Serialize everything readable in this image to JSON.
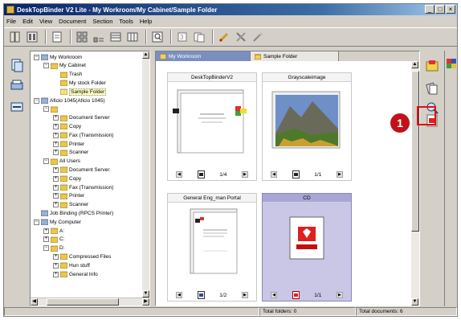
{
  "window": {
    "title": "DeskTopBinder V2 Lite - My Workroom/My Cabinet/Sample Folder",
    "controls": [
      "_",
      "□",
      "×"
    ]
  },
  "menu": [
    "File",
    "Edit",
    "View",
    "Document",
    "Section",
    "Tools",
    "Help"
  ],
  "toolbar_icons": [
    "binder-icon",
    "binder2-icon",
    "properties-icon",
    "thumbnails-icon",
    "details-icon",
    "list-icon",
    "zoom-icon",
    "print-icon",
    "copy-icon",
    "pen-icon",
    "tools-icon",
    "wand-icon"
  ],
  "tree": [
    {
      "label": "My Workroom",
      "level": 0,
      "expander": "−"
    },
    {
      "label": "My Cabinet",
      "level": 1,
      "expander": "−"
    },
    {
      "label": "Trash",
      "level": 2,
      "expander": ""
    },
    {
      "label": "My stock Folder",
      "level": 2,
      "expander": ""
    },
    {
      "label": "Sample Folder",
      "level": 2,
      "expander": "",
      "selected": true
    },
    {
      "label": "Aficio 1045(Aficio 1045)",
      "level": 0,
      "expander": "−"
    },
    {
      "label": "",
      "level": 1,
      "expander": "−"
    },
    {
      "label": "Document Server",
      "level": 2,
      "expander": "+"
    },
    {
      "label": "Copy",
      "level": 2,
      "expander": "+"
    },
    {
      "label": "Fax (Transmission)",
      "level": 2,
      "expander": "+"
    },
    {
      "label": "Printer",
      "level": 2,
      "expander": "+"
    },
    {
      "label": "Scanner",
      "level": 2,
      "expander": "+"
    },
    {
      "label": "All Users",
      "level": 1,
      "expander": "−"
    },
    {
      "label": "Document Server",
      "level": 2,
      "expander": "+"
    },
    {
      "label": "Copy",
      "level": 2,
      "expander": "+"
    },
    {
      "label": "Fax (Transmission)",
      "level": 2,
      "expander": "+"
    },
    {
      "label": "Printer",
      "level": 2,
      "expander": "+"
    },
    {
      "label": "Scanner",
      "level": 2,
      "expander": "+"
    },
    {
      "label": "Job Binding (RPCS Printer)",
      "level": 0,
      "expander": ""
    },
    {
      "label": "My Computer",
      "level": 0,
      "expander": "−"
    },
    {
      "label": "A:",
      "level": 1,
      "expander": "+"
    },
    {
      "label": "C:",
      "level": 1,
      "expander": "+"
    },
    {
      "label": "D:",
      "level": 1,
      "expander": "−"
    },
    {
      "label": "Compressed Files",
      "level": 2,
      "expander": "+"
    },
    {
      "label": "Hun stuff",
      "level": 2,
      "expander": "+"
    },
    {
      "label": "General Info",
      "level": 2,
      "expander": "+"
    }
  ],
  "tabs": [
    {
      "label": "My Workroom",
      "active": true
    },
    {
      "label": "Sample Folder",
      "active": false
    }
  ],
  "documents": [
    {
      "name": "DeskTopBinderV2",
      "page": "1/4",
      "kind": "doc",
      "selected": false
    },
    {
      "name": "Grayscaleimage",
      "page": "1/1",
      "kind": "photo",
      "selected": false
    },
    {
      "name": "General Eng_man Portal",
      "page": "1/2",
      "kind": "doc2",
      "selected": false
    },
    {
      "name": "CD",
      "page": "1/1",
      "kind": "pdf",
      "selected": true
    }
  ],
  "callout": {
    "number": "1"
  },
  "status": {
    "folders": "Total folders: 0",
    "documents": "Total documents: 6"
  }
}
